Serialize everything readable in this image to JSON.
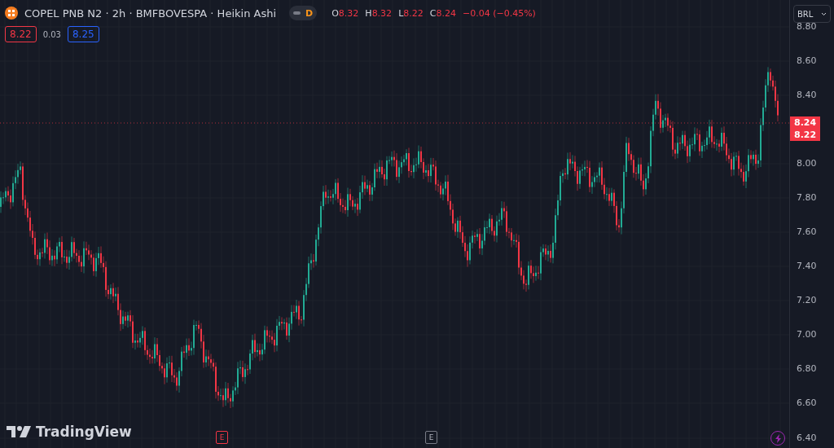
{
  "header": {
    "title": "COPEL PNB N2 · 2h · BMFBOVESPA · Heikin Ashi",
    "badge": "D",
    "ohlc": [
      {
        "label": "O",
        "value": "8.32"
      },
      {
        "label": "H",
        "value": "8.32"
      },
      {
        "label": "L",
        "value": "8.22"
      },
      {
        "label": "C",
        "value": "8.24"
      }
    ],
    "change": "−0.04 (−0.45%)"
  },
  "quote": {
    "bid": "8.22",
    "spread": "0.03",
    "ask": "8.25"
  },
  "currency": "BRL",
  "price_axis": [
    "8.80",
    "8.60",
    "8.40",
    "8.00",
    "7.80",
    "7.60",
    "7.40",
    "7.20",
    "7.00",
    "6.80",
    "6.60",
    "6.40"
  ],
  "price_tags": [
    "8.24",
    "8.22"
  ],
  "events": [
    {
      "kind": "earnings",
      "label": "E"
    },
    {
      "kind": "upcoming",
      "label": "E"
    }
  ],
  "logo": "TradingView"
}
